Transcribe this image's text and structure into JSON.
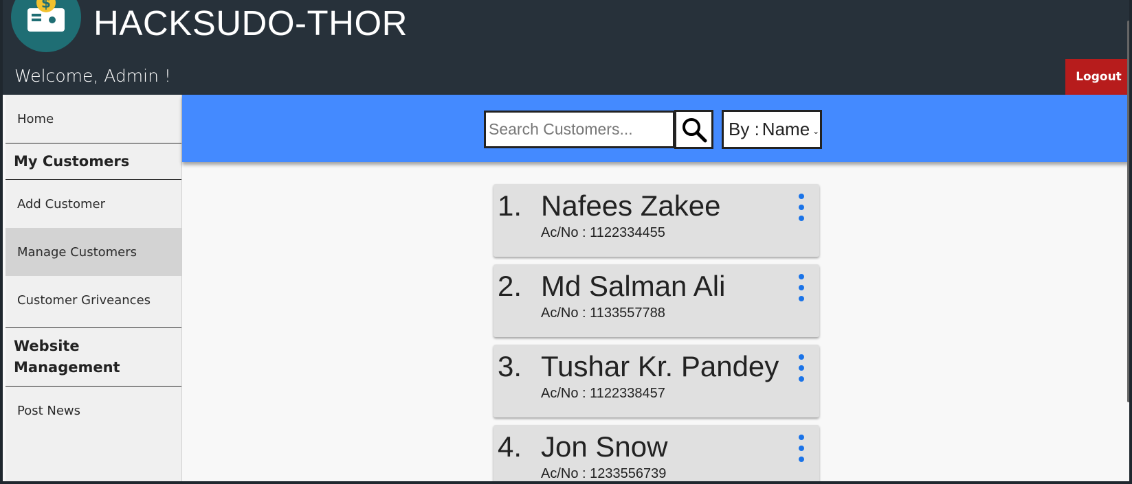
{
  "header": {
    "app_title": "HACKSUDO-THOR",
    "welcome": "Welcome,  Admin !",
    "logout_label": "Logout",
    "logo_icon": "dollar-card-icon"
  },
  "sidebar": {
    "items": [
      {
        "label": "Home"
      },
      {
        "label": "My Customers",
        "heading": true
      },
      {
        "label": "Add Customer"
      },
      {
        "label": "Manage Customers",
        "active": true
      },
      {
        "label": "Customer Griveances"
      },
      {
        "label": "Website Management",
        "heading": true
      },
      {
        "label": "Post News"
      }
    ]
  },
  "search": {
    "placeholder": "Search Customers...",
    "by_label": "By :",
    "by_value": "Name",
    "button_icon": "search-icon"
  },
  "customers": [
    {
      "num": "1.",
      "name": "Nafees Zakee",
      "ac": "Ac/No : 1122334455"
    },
    {
      "num": "2.",
      "name": "Md Salman Ali",
      "ac": "Ac/No : 1133557788"
    },
    {
      "num": "3.",
      "name": "Tushar Kr. Pandey",
      "ac": "Ac/No : 1122338457"
    },
    {
      "num": "4.",
      "name": "Jon Snow",
      "ac": "Ac/No : 1233556739"
    }
  ],
  "colors": {
    "header_bg": "#27313a",
    "search_bar_bg": "#448aff",
    "logout_bg": "#b71c1c",
    "menu_dot": "#1a73e8"
  }
}
